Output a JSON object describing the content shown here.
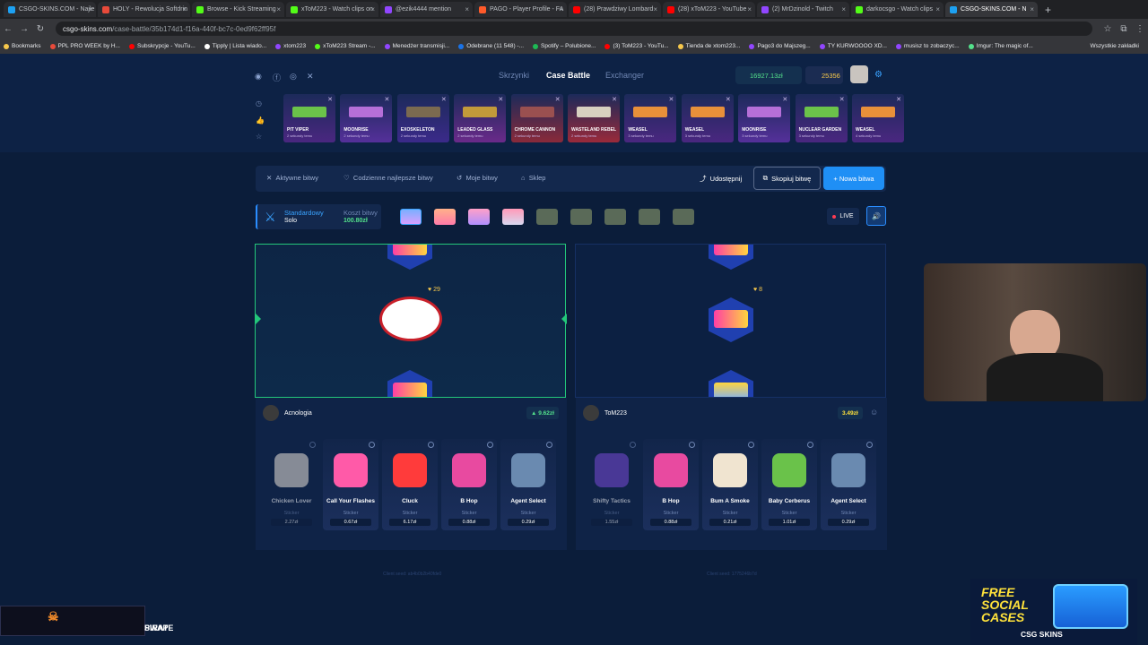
{
  "browser": {
    "tabs": [
      "CSGO-SKINS.COM - Najle",
      "HOLY - Rewolucja Softdrin",
      "Browse - Kick Streaming",
      "xToM223 - Watch clips on",
      "@ezik4444 mention",
      "PAGO - Player Profile - FA",
      "(28) Prawdziwy Lombard",
      "(28) xToM223 - YouTube",
      "(2) MrDzinold - Twitch",
      "darkocsgo - Watch clips",
      "CSGO-SKINS.COM - N"
    ],
    "active_tab": 10,
    "url_host": "csgo-skins.com",
    "url_path": "/case-battle/35b174d1-f16a-440f-bc7c-0ed9f62ff95f",
    "bookmarks": [
      "Bookmarks",
      "PPL PRO WEEK by H...",
      "Subskrypcje - YouTu...",
      "Tipply | Lista wiado...",
      "xtom223",
      "xToM223 Stream -...",
      "Menedżer transmisji...",
      "Odebrane (11 548) -...",
      "Spotify – Polubione...",
      "(3) ToM223 - YouTu...",
      "Tienda de xtom223...",
      "Pago3 do Majszeg...",
      "TY KURWOOOO XD...",
      "musisz to zobaczyc...",
      "Imgur: The magic of..."
    ],
    "bookmarks_right": "Wszystkie zakładki"
  },
  "header": {
    "nav": [
      "Skrzynki",
      "Case Battle",
      "Exchanger"
    ],
    "balance": "16927.13zł",
    "coins": "25356"
  },
  "live_drops": [
    {
      "name": "PIT VIPER",
      "sub": "2 sekundy temu",
      "bg": "#4a2780",
      "gun": "#6bc24a"
    },
    {
      "name": "MOONRISE",
      "sub": "2 sekundy temu",
      "bg": "#55309a",
      "gun": "#b66fd8"
    },
    {
      "name": "EXOSKELETON",
      "sub": "2 sekundy temu",
      "bg": "#3b2a8a",
      "gun": "#7b6a50"
    },
    {
      "name": "LEADED GLASS",
      "sub": "2 sekundy temu",
      "bg": "#6a2a8a",
      "gun": "#c29a3a"
    },
    {
      "name": "CHROME CANNON",
      "sub": "2 sekundy temu",
      "bg": "#8a2a3a",
      "gun": "#9a5050"
    },
    {
      "name": "WASTELAND REBEL",
      "sub": "2 sekundy temu",
      "bg": "#9a2a3a",
      "gun": "#d8d0c0"
    },
    {
      "name": "WEASEL",
      "sub": "3 sekundy temu",
      "bg": "#4a2780",
      "gun": "#e8903a"
    },
    {
      "name": "WEASEL",
      "sub": "3 sekundy temu",
      "bg": "#4a2780",
      "gun": "#e8903a"
    },
    {
      "name": "MOONRISE",
      "sub": "3 sekundy temu",
      "bg": "#55309a",
      "gun": "#b66fd8"
    },
    {
      "name": "NUCLEAR GARDEN",
      "sub": "3 sekundy temu",
      "bg": "#4a2780",
      "gun": "#6bc24a"
    },
    {
      "name": "WEASEL",
      "sub": "4 sekundy temu",
      "bg": "#4a2780",
      "gun": "#e8903a"
    }
  ],
  "toolbar": {
    "active": "Aktywne bitwy",
    "best": "Codzienne najlepsze bitwy",
    "mine": "Moje bitwy",
    "shop": "Sklep",
    "share": "Udostępnij",
    "copy": "Skopiuj bitwę",
    "new": "+ Nowa bitwa"
  },
  "battle": {
    "mode_label": "Standardowy",
    "mode_value": "Solo",
    "cost_label": "Koszt bitwy",
    "cost_value": "100.80zł",
    "live": "LIVE"
  },
  "players": [
    {
      "name": "Acnologia",
      "total": "▲ 9.62zł",
      "total_color": "#53e08b",
      "reel_heart": "29",
      "items": [
        {
          "name": "Chicken Lover",
          "type": "Sticker",
          "price": "2.27zł",
          "color": "#e8e0d8",
          "ghost": true
        },
        {
          "name": "Call Your Flashes",
          "type": "Sticker",
          "price": "0.67zł",
          "color": "#ff5aa8"
        },
        {
          "name": "Cluck",
          "type": "Sticker",
          "price": "6.17zł",
          "color": "#ff3b3b"
        },
        {
          "name": "B Hop",
          "type": "Sticker",
          "price": "0.88zł",
          "color": "#e84aa0"
        },
        {
          "name": "Agent Select",
          "type": "Sticker",
          "price": "0.29zł",
          "color": "#6a8ab0"
        }
      ]
    },
    {
      "name": "ToM223",
      "total": "3.49zł",
      "total_color": "#ffe23b",
      "reel_heart": "8",
      "items": [
        {
          "name": "Shifty Tactics",
          "type": "Sticker",
          "price": "1.55zł",
          "color": "#7a4ad8",
          "ghost": true
        },
        {
          "name": "B Hop",
          "type": "Sticker",
          "price": "0.88zł",
          "color": "#e84aa0"
        },
        {
          "name": "Bum A Smoke",
          "type": "Sticker",
          "price": "0.21zł",
          "color": "#f0e4d0"
        },
        {
          "name": "Baby Cerberus",
          "type": "Sticker",
          "price": "1.01zł",
          "color": "#6ac24a"
        },
        {
          "name": "Agent Select",
          "type": "Sticker",
          "price": "0.29zł",
          "color": "#6a8ab0"
        }
      ]
    }
  ],
  "seeds": [
    "Client seed: ab4b0b2b40fde0",
    "Client seed: 1775246b7d"
  ],
  "overlays": {
    "pirate_line1": "PIRATE",
    "pirate_line2": "SWAP",
    "promo_title": "FREE SOCIAL CASES",
    "promo_brand": "CSG SKINS"
  }
}
